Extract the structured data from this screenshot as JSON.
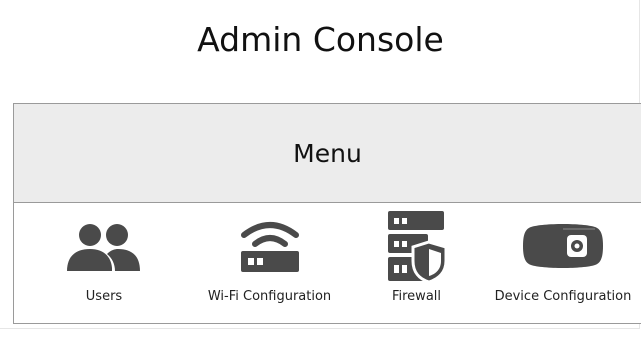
{
  "page": {
    "title": "Admin Console"
  },
  "menu": {
    "title": "Menu",
    "items": [
      {
        "label": "Users",
        "icon": "users-icon"
      },
      {
        "label": "Wi-Fi Configuration",
        "icon": "wifi-router-icon"
      },
      {
        "label": "Firewall",
        "icon": "firewall-icon"
      },
      {
        "label": "Device Configuration",
        "icon": "device-icon"
      }
    ]
  },
  "colors": {
    "icon": "#4a4a4a",
    "menu_header_bg": "#ececec",
    "border": "#9a9a9a",
    "text": "#111111"
  }
}
